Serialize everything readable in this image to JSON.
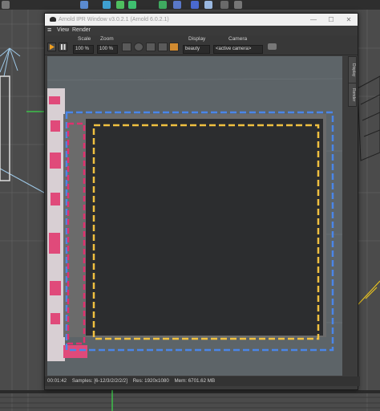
{
  "window": {
    "title": "Arnold IPR Window v3.0.2.1 (Arnold 6.0.2.1)",
    "controls": {
      "minimize": "—",
      "maximize": "☐",
      "close": "✕"
    }
  },
  "menu": {
    "view": "View",
    "render": "Render"
  },
  "toolbar": {
    "scale_label": "Scale",
    "scale_value": "100 %",
    "zoom_label": "Zoom",
    "zoom_value": "100 %",
    "display_label": "Display",
    "display_value": "beauty",
    "camera_label": "Camera",
    "camera_value": "<active camera>"
  },
  "side_tabs": [
    "Display",
    "Render"
  ],
  "status": {
    "time": "00:01:42",
    "samples": "Samples: [6-12/3/2/2/2/2]",
    "res": "Res: 1920x1080",
    "mem": "Mem: 6701.62 MB"
  },
  "colors": {
    "safe_frame_outer": "#4a86e8",
    "safe_frame_inner": "#f0c040",
    "pink_guide": "#e0306e",
    "screen": "#2c2d2f"
  },
  "icons": [
    "menu-icon",
    "play-icon",
    "pause-icon",
    "region-icon",
    "crop-icon",
    "lock-icon",
    "color-icon",
    "camera-snapshot-icon"
  ]
}
